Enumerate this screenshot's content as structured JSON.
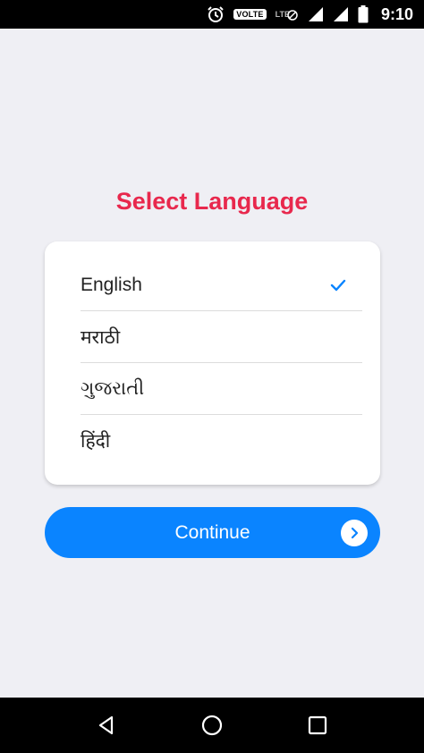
{
  "status_bar": {
    "volte_label": "VOLTE",
    "network_label": "LTE",
    "time": "9:10",
    "icons": [
      "alarm-icon",
      "volte-badge",
      "no-sim-icon",
      "signal-icon",
      "signal-icon",
      "battery-icon"
    ]
  },
  "screen": {
    "title": "Select Language",
    "title_color": "#e8284d"
  },
  "languages": [
    {
      "label": "English",
      "selected": true
    },
    {
      "label": "मराठी",
      "selected": false
    },
    {
      "label": "ગુજરાતી",
      "selected": false
    },
    {
      "label": "हिंदी",
      "selected": false
    }
  ],
  "continue_button": {
    "label": "Continue",
    "color": "#0a84ff",
    "icon": "chevron-right-circle-icon"
  },
  "nav_bar": {
    "icons": [
      "back-icon",
      "home-icon",
      "recents-icon"
    ]
  }
}
